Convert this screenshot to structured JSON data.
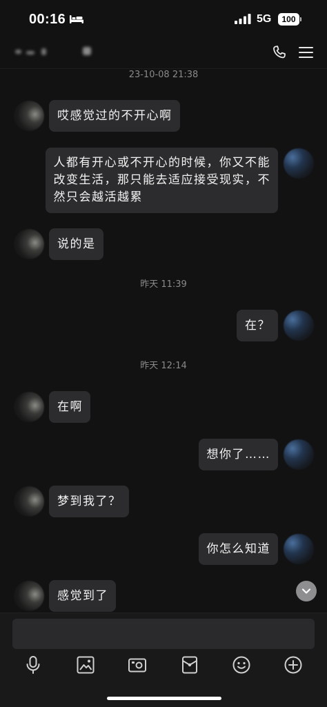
{
  "status_bar": {
    "time": "00:16",
    "focus_icon": "bed-icon",
    "signal_icon": "cellular-signal-icon",
    "network": "5G",
    "battery": "100"
  },
  "header": {
    "call_icon": "phone-icon",
    "menu_icon": "menu-icon"
  },
  "chat": {
    "timeline": [
      {
        "timestamp": "23-10-08 21:38"
      },
      {
        "incoming": "哎感觉过的不开心啊"
      },
      {
        "outgoing_lines": [
          "人都有开心或不开心的时候，你又不能",
          "改变生活，那只能去适应接受现实，不",
          "然只会越活越累"
        ]
      },
      {
        "incoming": "说的是"
      },
      {
        "timestamp": "昨天 11:39"
      },
      {
        "outgoing": "在？"
      },
      {
        "timestamp": "昨天 12:14"
      },
      {
        "incoming": "在啊"
      },
      {
        "outgoing": "想你了……"
      },
      {
        "incoming": "梦到我了？"
      },
      {
        "outgoing": "你怎么知道"
      },
      {
        "incoming": "感觉到了"
      }
    ],
    "scroll_down_icon": "chevron-down-icon"
  },
  "composer": {
    "toolbar_icons": [
      "mic-icon",
      "image-icon",
      "camera-icon",
      "red-packet-icon",
      "emoji-icon",
      "plus-icon"
    ]
  },
  "colors": {
    "background": "#121213",
    "panel": "#19191a",
    "bubble": "#2c2c2e",
    "text": "#f2f2f2",
    "timestamp": "#8a8a8a",
    "icon": "#d0d0d0",
    "scroll_button": "#8e8e90",
    "input": "#2a2a2c"
  }
}
